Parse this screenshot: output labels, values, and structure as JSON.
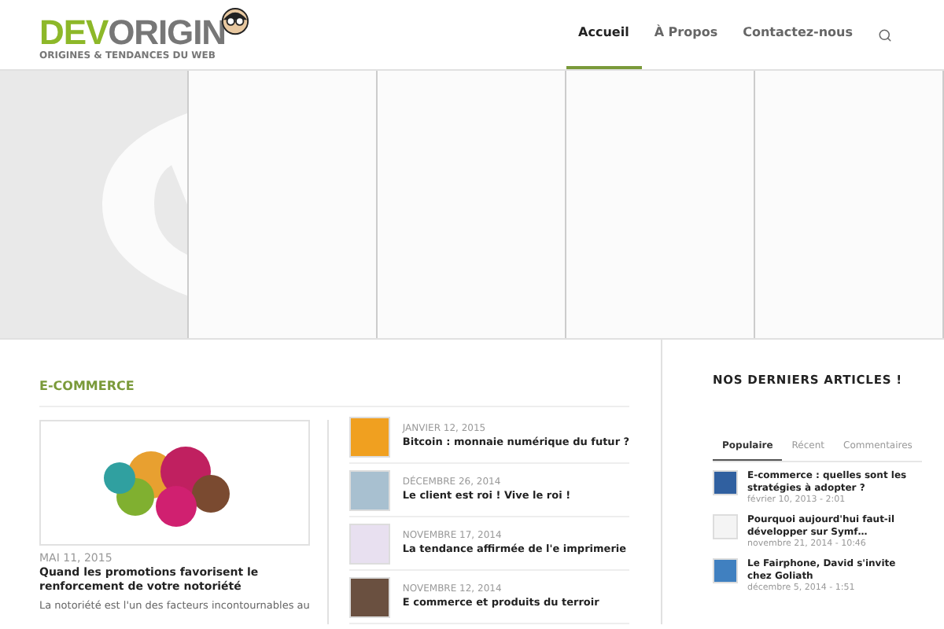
{
  "logo": {
    "part_1": "DEV",
    "part_2": "ORIGIN",
    "tagline": "ORIGINES & TENDANCES DU WEB"
  },
  "nav": [
    {
      "label": "Accueil",
      "selected": true
    },
    {
      "label": "À Propos",
      "selected": false
    },
    {
      "label": "Contactez-nous",
      "selected": false
    }
  ],
  "section": {
    "title": "E-COMMERCE",
    "featured": {
      "date": "MAI 11, 2015",
      "title": "Quand les promotions favorisent le renforcement de votre notoriété",
      "excerpt": "La notoriété est l'un des facteurs incontournables au"
    },
    "posts": [
      {
        "date": "JANVIER 12, 2015",
        "title": "Bitcoin : monnaie numérique du futur ?",
        "color": "#f0a020"
      },
      {
        "date": "DÉCEMBRE 26, 2014",
        "title": "Le client est roi ! Vive le roi !",
        "color": "#a8c0d0"
      },
      {
        "date": "NOVEMBRE 17, 2014",
        "title": "La tendance affirmée de l'e imprimerie",
        "color": "#e8e0f0"
      },
      {
        "date": "NOVEMBRE 12, 2014",
        "title": "E commerce et produits du terroir",
        "color": "#6a5040"
      }
    ]
  },
  "sidebar": {
    "title": "NOS DERNIERS ARTICLES !",
    "tabs": [
      {
        "label": "Populaire",
        "selected": true
      },
      {
        "label": "Récent",
        "selected": false
      },
      {
        "label": "Commentaires",
        "selected": false
      }
    ],
    "articles": [
      {
        "title": "E-commerce : quelles sont les stratégies à adopter ?",
        "date": "février 10, 2013 - 2:01",
        "color": "#3060a0"
      },
      {
        "title": "Pourquoi aujourd'hui faut-il développer sur Symf…",
        "date": "novembre 21, 2014 - 10:46",
        "color": "#f4f4f4"
      },
      {
        "title": "Le Fairphone, David s'invite chez Goliath",
        "date": "décembre 5, 2014 - 1:51",
        "color": "#4080c0"
      }
    ]
  }
}
